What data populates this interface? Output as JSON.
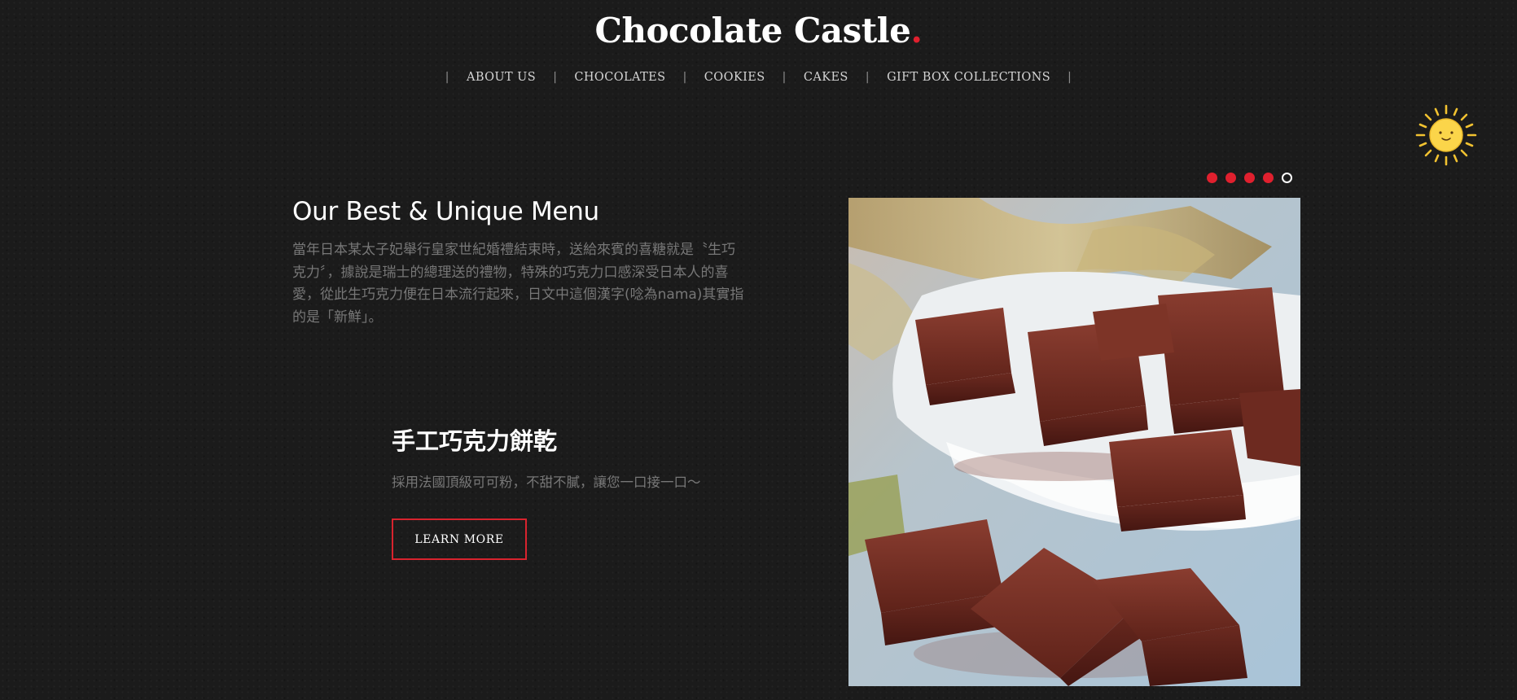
{
  "site": {
    "logo_text": "Chocolate Castle",
    "logo_dot": ".",
    "accent_color": "#e0202e"
  },
  "nav": {
    "separator": "|",
    "items": [
      {
        "label": "ABOUT US"
      },
      {
        "label": "CHOCOLATES"
      },
      {
        "label": "COOKIES"
      },
      {
        "label": "CAKES"
      },
      {
        "label": "GIFT BOX COLLECTIONS"
      }
    ]
  },
  "slider": {
    "dot_count": 5,
    "active_index": 5
  },
  "hero": {
    "title": "Our Best & Unique Menu",
    "description": "當年日本某太子妃舉行皇家世紀婚禮結束時，送給來賓的喜糖就是〝生巧克力〞，據說是瑞士的總理送的禮物，特殊的巧克力口感深受日本人的喜愛，從此生巧克力便在日本流行起來，日文中這個漢字(唸為nama)其實指的是「新鮮」。"
  },
  "product": {
    "title": "手工巧克力餅乾",
    "description": "採用法國頂級可可粉，不甜不膩，讓您一口接一口～",
    "button_label": "LEARN MORE"
  },
  "icons": {
    "sun": "sun-icon",
    "photo": "chocolate-photo"
  }
}
